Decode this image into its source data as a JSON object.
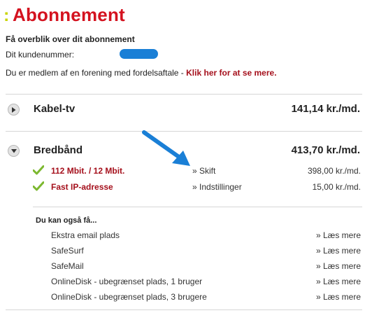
{
  "page": {
    "title_marker": ":",
    "title": "Abonnement"
  },
  "overview": {
    "heading": "Få overblik over dit abonnement",
    "customer_label": "Dit kundenummer:",
    "member_text": "Du er medlem af en forening med fordelsaftale - ",
    "member_link": "Klik her for at se mere."
  },
  "sections": [
    {
      "name": "Kabel-tv",
      "price": "141,14 kr./md.",
      "expanded": false
    },
    {
      "name": "Bredbånd",
      "price": "413,70 kr./md.",
      "expanded": true,
      "items": [
        {
          "name": "112 Mbit. / 12 Mbit.",
          "action": "» Skift",
          "price": "398,00 kr./md."
        },
        {
          "name": "Fast IP-adresse",
          "action": "» Indstillinger",
          "price": "15,00 kr./md."
        }
      ],
      "also": {
        "heading": "Du kan også få...",
        "items": [
          {
            "name": "Ekstra email plads",
            "link": "» Læs mere"
          },
          {
            "name": "SafeSurf",
            "link": "» Læs mere"
          },
          {
            "name": "SafeMail",
            "link": "» Læs mere"
          },
          {
            "name": "OnlineDisk - ubegrænset plads, 1 bruger",
            "link": "» Læs mere"
          },
          {
            "name": "OnlineDisk - ubegrænset plads, 3 brugere",
            "link": "» Læs mere"
          }
        ]
      }
    }
  ],
  "colors": {
    "title_red": "#d4121f",
    "link_red": "#a5101c",
    "marker_green": "#c8d400",
    "check_green": "#7cb82f",
    "annotation_blue": "#1a7fd6"
  },
  "icons": {
    "collapsed": "triangle-right-icon",
    "expanded": "triangle-down-icon",
    "included": "checkmark-icon",
    "annotation": "arrow-icon"
  }
}
